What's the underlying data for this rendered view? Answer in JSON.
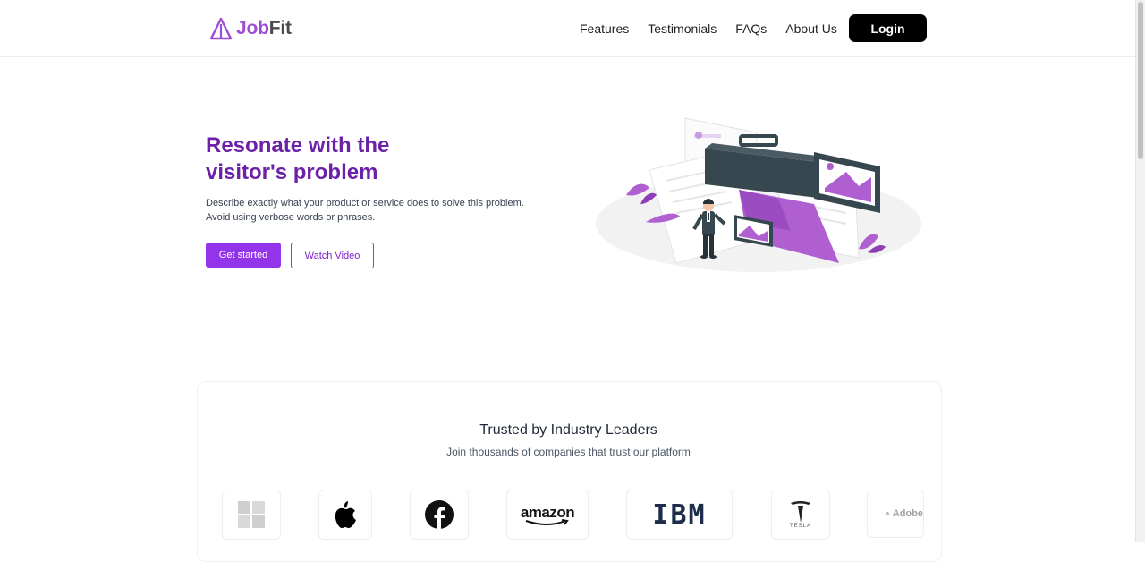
{
  "header": {
    "logo": {
      "part1": "Job",
      "part2": "Fit"
    },
    "nav": [
      "Features",
      "Testimonials",
      "FAQs",
      "About Us"
    ],
    "login_label": "Login"
  },
  "hero": {
    "title_line1": "Resonate with the",
    "title_line2": "visitor's problem",
    "desc_line1": "Describe exactly what your product or service does to solve this problem.",
    "desc_line2": "Avoid using verbose words or phrases.",
    "primary_label": "Get started",
    "secondary_label": "Watch Video"
  },
  "trusted": {
    "title": "Trusted by Industry Leaders",
    "subtitle": "Join thousands of companies that trust our platform",
    "logos": {
      "amazon": "amazon",
      "ibm": "IBM",
      "tesla": "TESLA",
      "adobe": "Adobe"
    }
  },
  "colors": {
    "brand_purple": "#9333ea",
    "title_purple": "#6b21a8",
    "logo_purple": "#9b4dd6"
  }
}
